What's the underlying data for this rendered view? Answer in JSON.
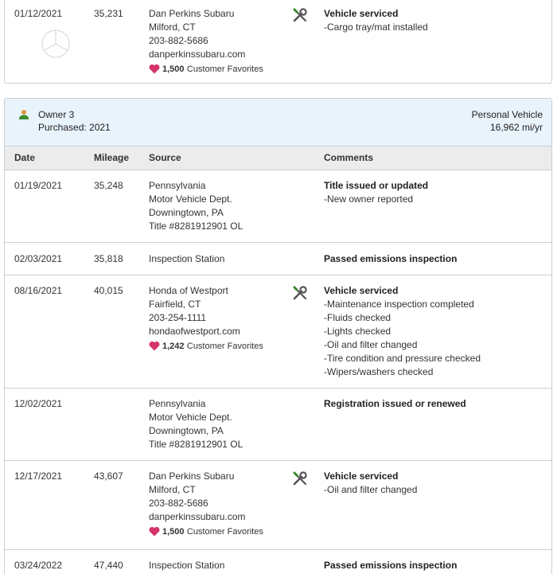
{
  "prev_record": {
    "date": "01/12/2021",
    "mileage": "35,231",
    "source_lines": [
      "Dan Perkins Subaru",
      "Milford, CT",
      "203-882-5686",
      "danperkinssubaru.com"
    ],
    "favorites_count": "1,500",
    "favorites_label": "Customer Favorites",
    "comment_title": "Vehicle serviced",
    "comment_items": [
      "Cargo tray/mat installed"
    ]
  },
  "owner": {
    "label": "Owner 3",
    "purchased": "Purchased: 2021",
    "vehicle_type": "Personal Vehicle",
    "miles_per_year": "16,962 mi/yr"
  },
  "table_headers": {
    "date": "Date",
    "mileage": "Mileage",
    "source": "Source",
    "comments": "Comments"
  },
  "records": [
    {
      "date": "01/19/2021",
      "mileage": "35,248",
      "source_lines": [
        "Pennsylvania",
        "Motor Vehicle Dept.",
        "Downingtown, PA",
        "Title #8281912901 OL"
      ],
      "comment_title": "Title issued or updated",
      "comment_items": [
        "New owner reported"
      ]
    },
    {
      "date": "02/03/2021",
      "mileage": "35,818",
      "source_lines": [
        "Inspection Station"
      ],
      "comment_title": "Passed emissions inspection",
      "comment_items": []
    },
    {
      "date": "08/16/2021",
      "mileage": "40,015",
      "source_lines": [
        "Honda of Westport",
        "Fairfield, CT",
        "203-254-1111",
        "hondaofwestport.com"
      ],
      "favorites_count": "1,242",
      "favorites_label": "Customer Favorites",
      "comment_title": "Vehicle serviced",
      "comment_items": [
        "Maintenance inspection completed",
        "Fluids checked",
        "Lights checked",
        "Oil and filter changed",
        "Tire condition and pressure checked",
        "Wipers/washers checked"
      ]
    },
    {
      "date": "12/02/2021",
      "mileage": "",
      "source_lines": [
        "Pennsylvania",
        "Motor Vehicle Dept.",
        "Downingtown, PA",
        "Title #8281912901 OL"
      ],
      "comment_title": "Registration issued or renewed",
      "comment_items": []
    },
    {
      "date": "12/17/2021",
      "mileage": "43,607",
      "source_lines": [
        "Dan Perkins Subaru",
        "Milford, CT",
        "203-882-5686",
        "danperkinssubaru.com"
      ],
      "favorites_count": "1,500",
      "favorites_label": "Customer Favorites",
      "comment_title": "Vehicle serviced",
      "comment_items": [
        "Oil and filter changed"
      ]
    },
    {
      "date": "03/24/2022",
      "mileage": "47,440",
      "source_lines": [
        "Inspection Station"
      ],
      "comment_title": "Passed emissions inspection",
      "comment_items": []
    }
  ],
  "colors": {
    "header_bg": "#e9f3fb",
    "table_head_bg": "#ececec",
    "heart": "#d6336c",
    "owner_icon": "#3a8a2e",
    "tools_icon": "#555555"
  }
}
